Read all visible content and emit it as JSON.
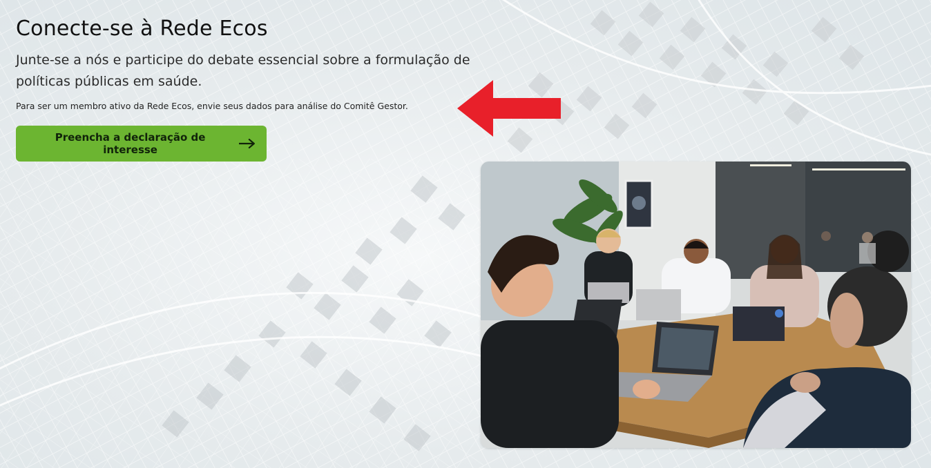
{
  "section": {
    "title": "Conecte-se à Rede Ecos",
    "lead": "Junte-se a nós e participe do debate essencial sobre a formulação de políticas públicas em saúde.",
    "note": "Para ser um membro ativo da Rede Ecos, envie seus dados para análise do Comitê Gestor.",
    "cta_label": "Preencha a declaração de interesse"
  },
  "icons": {
    "cta_icon": "arrow-right-icon",
    "annotation_icon": "red-arrow-left-icon"
  },
  "colors": {
    "cta_background": "#6cb531",
    "annotation_red": "#e8202a",
    "title_text": "#111111"
  }
}
